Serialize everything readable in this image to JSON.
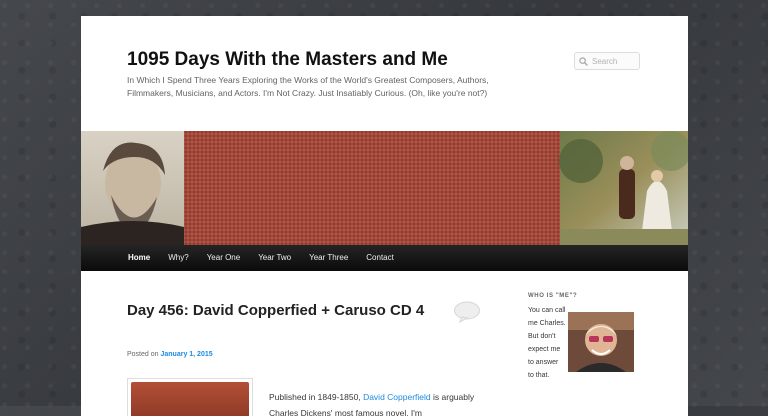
{
  "site": {
    "title": "1095 Days With the Masters and Me",
    "description": "In Which I Spend Three Years Exploring the Works of the World's Greatest Composers, Authors, Filmmakers, Musicians, and Actors. I'm Not Crazy. Just Insatiably Curious. (Oh, like you're not?)"
  },
  "search": {
    "placeholder": "Search"
  },
  "nav": {
    "items": [
      {
        "label": "Home"
      },
      {
        "label": "Why?"
      },
      {
        "label": "Year One"
      },
      {
        "label": "Year Two"
      },
      {
        "label": "Year Three"
      },
      {
        "label": "Contact"
      }
    ]
  },
  "post": {
    "title": "Day 456: David Copperfied + Caruso CD 4",
    "posted_prefix": "Posted on",
    "date": "January 1, 2015",
    "body_prefix": "Published in 1849-1850,",
    "body_link": "David Copperfield",
    "body_suffix": "is arguably Charles Dickens' most famous novel. I'm"
  },
  "sidebar": {
    "widget_title": "WHO IS \"ME\"?",
    "widget_text": "You can call me Charles. But don't expect me to answer to that."
  },
  "icons": {
    "search": "search-icon",
    "comment": "comment-bubble-icon"
  },
  "colors": {
    "link": "#1b8be0",
    "nav_bg": "#111111",
    "header_cloth": "#a0493a"
  }
}
